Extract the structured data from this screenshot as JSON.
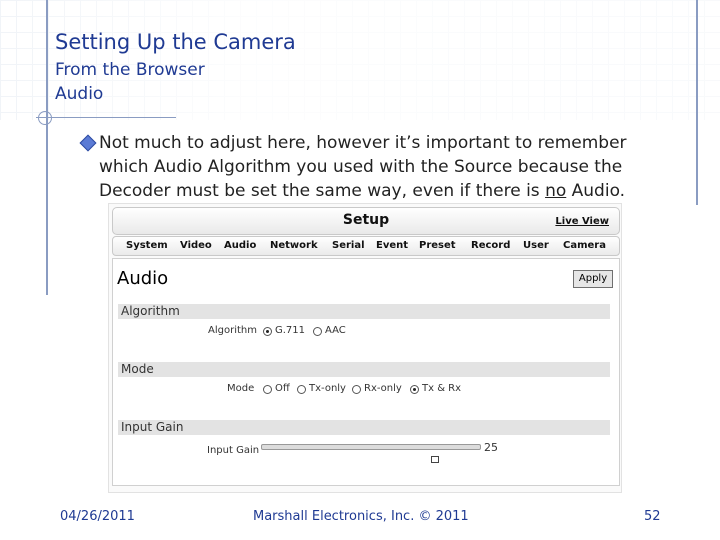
{
  "slide": {
    "title": "Setting Up the Camera",
    "subtitle1": "From the Browser",
    "subtitle2": "Audio",
    "bullet_before": "Not much to adjust here, however it’s important to remember which Audio Algorithm you used with the Source because the Decoder must be set the same way, even if there is ",
    "bullet_emph": "no",
    "bullet_after": " Audio."
  },
  "camera_ui": {
    "setup_title": "Setup",
    "live_view": "Live View",
    "nav": [
      "System",
      "Video",
      "Audio",
      "Network",
      "Serial",
      "Event",
      "Preset",
      "Record",
      "User",
      "Camera"
    ],
    "panel_title": "Audio",
    "apply": "Apply",
    "sections": {
      "algorithm": {
        "header": "Algorithm",
        "label": "Algorithm",
        "options": [
          "G.711",
          "AAC"
        ],
        "selected": "G.711"
      },
      "mode": {
        "header": "Mode",
        "label": "Mode",
        "options": [
          "Off",
          "Tx-only",
          "Rx-only",
          "Tx & Rx"
        ],
        "selected": "Tx & Rx"
      },
      "input_gain": {
        "header": "Input Gain",
        "label": "Input Gain",
        "value": "25"
      }
    }
  },
  "footer": {
    "date": "04/26/2011",
    "company": "Marshall Electronics, Inc. © 2011",
    "page": "52"
  },
  "colors": {
    "title": "#1f3a93",
    "accent_line": "#8a9cc2"
  }
}
